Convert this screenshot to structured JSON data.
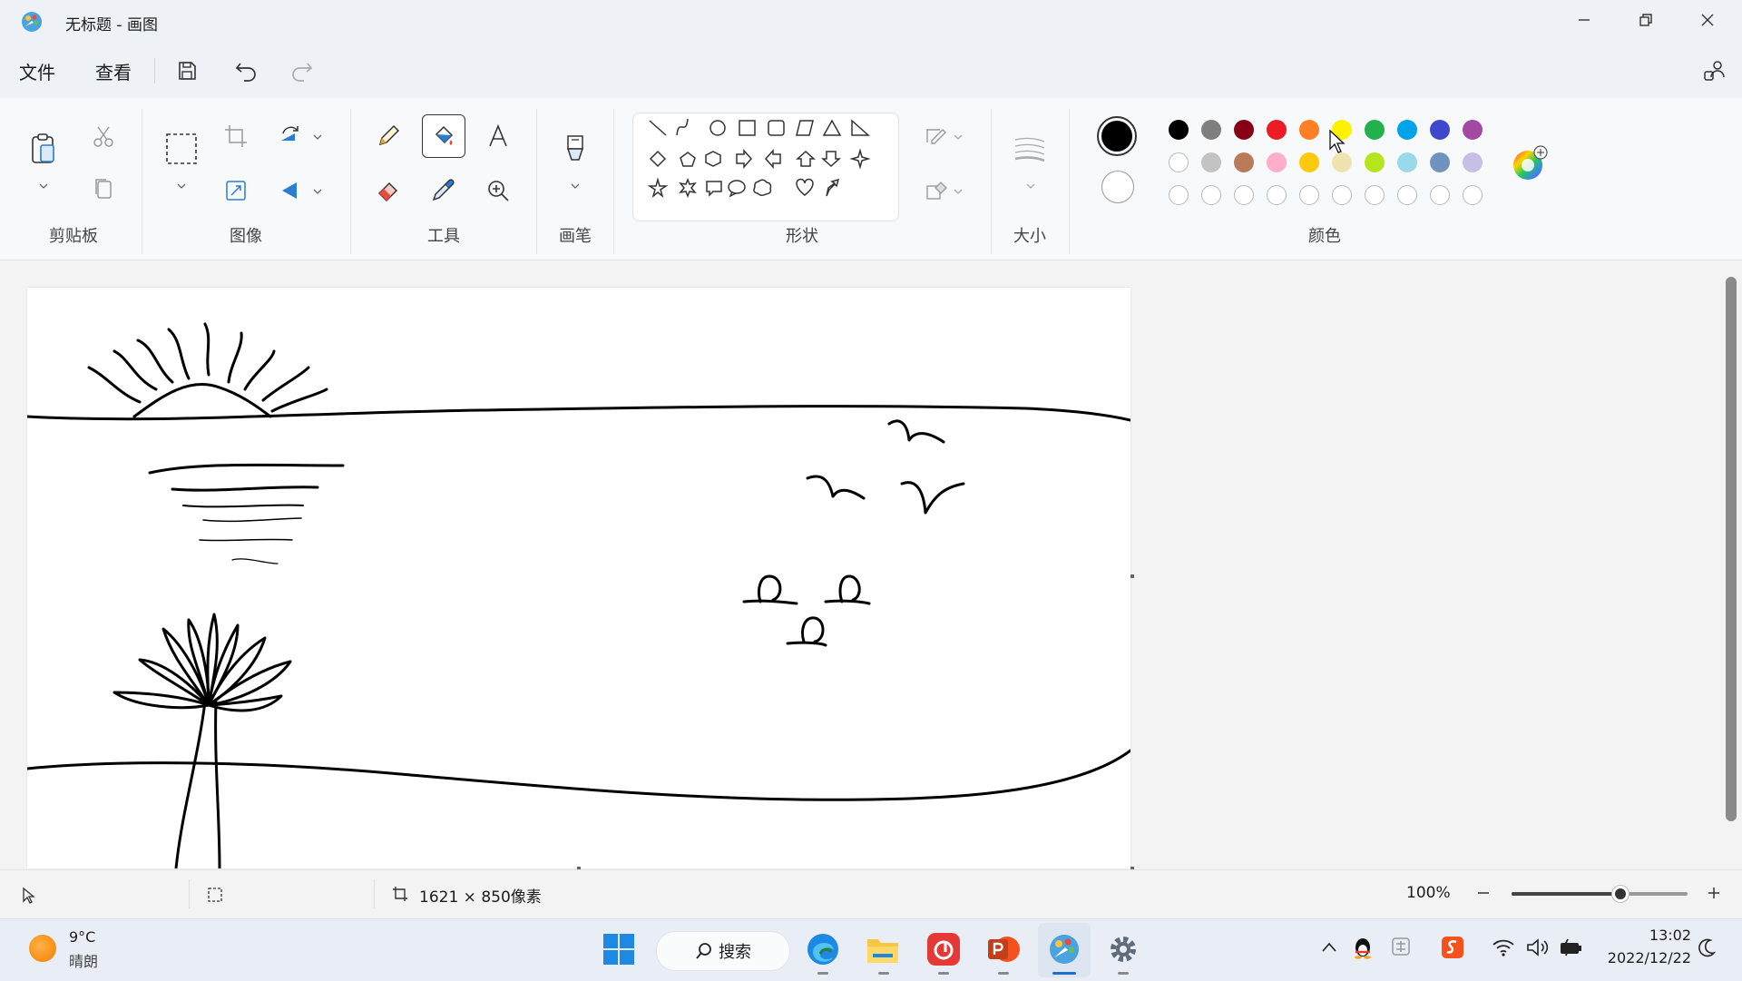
{
  "window": {
    "title": "无标题 - 画图"
  },
  "menu": {
    "file": "文件",
    "view": "查看"
  },
  "ribbon": {
    "groups": {
      "clipboard": "剪贴板",
      "image": "图像",
      "tools": "工具",
      "brushes": "画笔",
      "shapes": "形状",
      "size": "大小",
      "colors": "颜色"
    }
  },
  "colors": {
    "primary": "#000000",
    "secondary": "#ffffff",
    "palette_row1": [
      "#000000",
      "#7f7f7f",
      "#880015",
      "#ed1c24",
      "#ff7f27",
      "#fff200",
      "#22b14c",
      "#00a2e8",
      "#3f48cc",
      "#a349a4"
    ],
    "palette_row2": [
      "#ffffff",
      "#c3c3c3",
      "#b97a57",
      "#ffaec9",
      "#ffc90e",
      "#efe4b0",
      "#b5e61d",
      "#99d9ea",
      "#7092be",
      "#c8bfe7"
    ],
    "palette_row3_empty_count": 10
  },
  "status": {
    "canvas_size": "1621 × 850像素",
    "zoom": "100%",
    "zoom_fraction": 0.62
  },
  "taskbar": {
    "weather_temp": "9°C",
    "weather_desc": "晴朗",
    "search_label": "搜索",
    "time": "13:02",
    "date": "2022/12/22"
  }
}
